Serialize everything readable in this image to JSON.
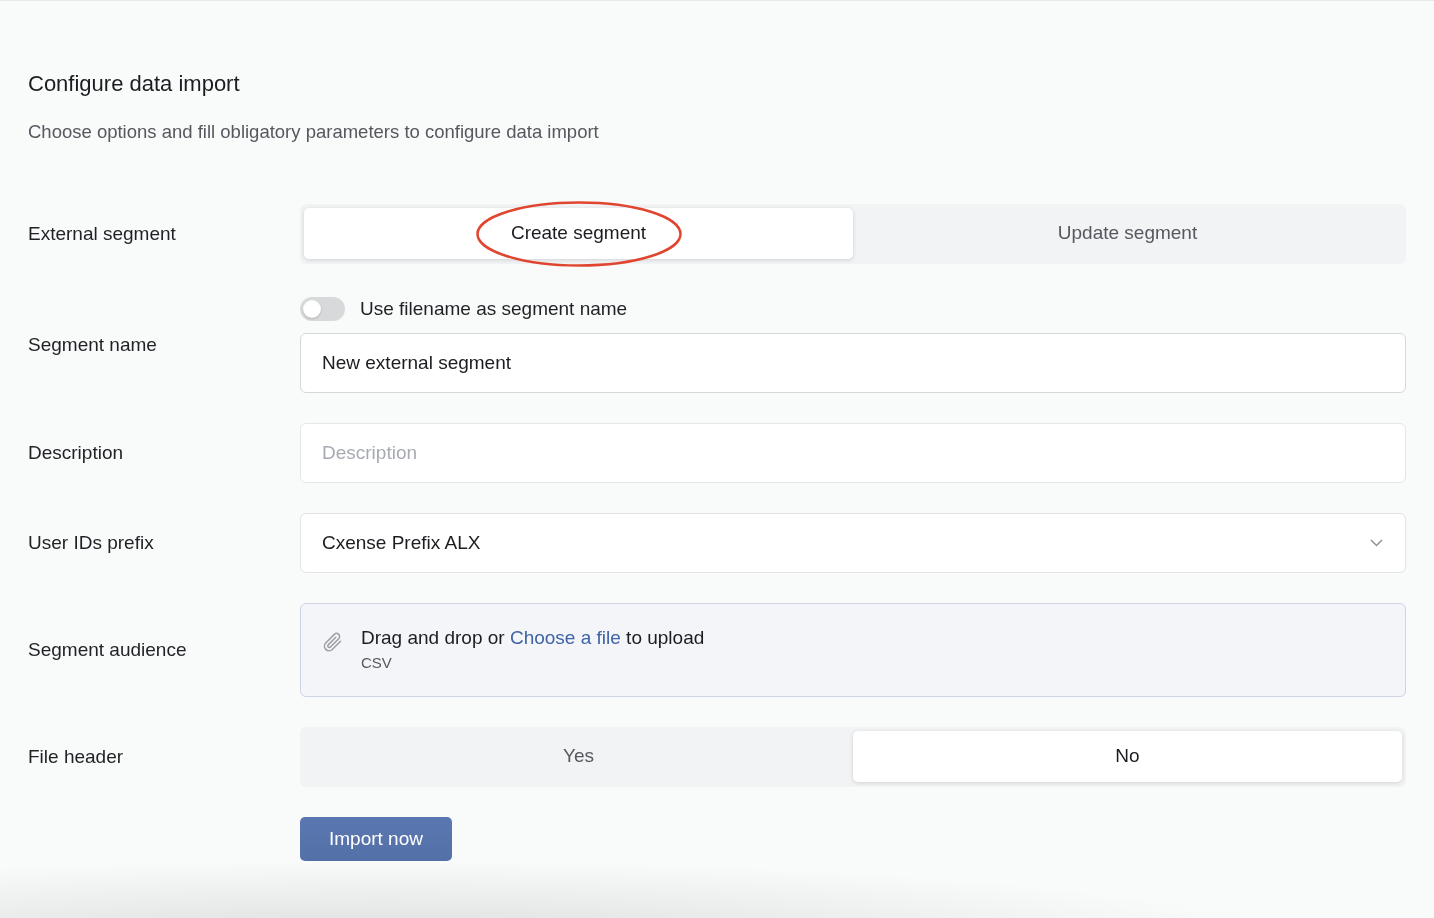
{
  "header": {
    "title": "Configure data import",
    "subtitle": "Choose options and fill obligatory parameters to configure data import"
  },
  "fields": [
    {
      "kind": "segmented",
      "label": "External segment",
      "options": [
        {
          "label": "Create segment",
          "selected": true,
          "circled": true
        },
        {
          "label": "Update segment",
          "selected": false,
          "circled": false
        }
      ]
    },
    {
      "kind": "text",
      "label": "Segment name",
      "toggle": {
        "label": "Use filename as segment name",
        "on": false
      },
      "value": "New external segment"
    },
    {
      "kind": "text",
      "label": "Description",
      "placeholder": "Description"
    },
    {
      "kind": "select",
      "label": "User IDs prefix",
      "value": "Cxense Prefix ALX"
    },
    {
      "kind": "upload",
      "label": "Segment audience",
      "text_before": "Drag and drop or",
      "link": "Choose a file",
      "text_after": "to upload",
      "hint": "CSV"
    },
    {
      "kind": "segmented",
      "label": "File header",
      "options": [
        {
          "label": "Yes",
          "selected": false,
          "circled": false
        },
        {
          "label": "No",
          "selected": true,
          "circled": false
        }
      ]
    }
  ],
  "submit": {
    "label": "Import now"
  }
}
